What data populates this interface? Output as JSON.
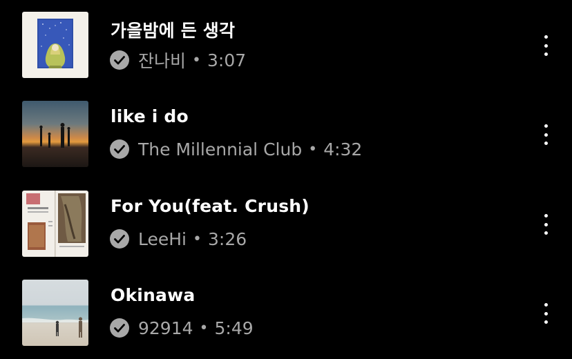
{
  "tracks": [
    {
      "title": "가을밤에 든 생각",
      "artist": "잔나비",
      "separator": "•",
      "duration": "3:07",
      "thumbnail_icon": "album-art-blue-night-painting",
      "verified_icon": "verified-check-icon",
      "menu_icon": "more-vert-icon"
    },
    {
      "title": "like i do",
      "artist": "The Millennial Club",
      "separator": "•",
      "duration": "4:32",
      "thumbnail_icon": "album-art-sunset-silhouettes",
      "verified_icon": "verified-check-icon",
      "menu_icon": "more-vert-icon"
    },
    {
      "title": "For You(feat. Crush)",
      "artist": "LeeHi",
      "separator": "•",
      "duration": "3:26",
      "thumbnail_icon": "album-art-magazine-collage",
      "verified_icon": "verified-check-icon",
      "menu_icon": "more-vert-icon"
    },
    {
      "title": "Okinawa",
      "artist": "92914",
      "separator": "•",
      "duration": "5:49",
      "thumbnail_icon": "album-art-beach",
      "verified_icon": "verified-check-icon",
      "menu_icon": "more-vert-icon"
    }
  ],
  "colors": {
    "background": "#000000",
    "title": "#ffffff",
    "subtitle": "#a8a8a8",
    "verified_badge": "#a8a8a8"
  }
}
